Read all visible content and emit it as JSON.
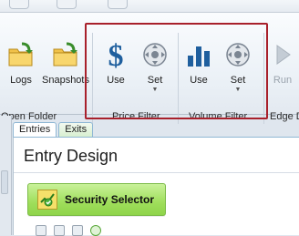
{
  "ribbon": {
    "open_folder": {
      "label": "Open Folder",
      "buttons": [
        {
          "label": "Logs",
          "icon": "folder-arrow-icon"
        },
        {
          "label": "Snapshots",
          "icon": "folder-arrow-icon"
        }
      ]
    },
    "price_filter": {
      "label": "Price Filter",
      "use_label": "Use",
      "set_label": "Set",
      "use_icon": "dollar-icon",
      "set_icon": "settings-dial-icon"
    },
    "volume_filter": {
      "label": "Volume Filter",
      "use_label": "Use",
      "set_label": "Set",
      "use_icon": "bar-chart-icon",
      "set_icon": "settings-dial-icon"
    },
    "edge": {
      "label": "Edge D",
      "run_label": "Run",
      "run_icon": "play-icon"
    }
  },
  "tabs": [
    {
      "label": "Entries",
      "active": true
    },
    {
      "label": "Exits",
      "active": false
    }
  ],
  "main": {
    "title": "Entry Design",
    "security_selector_label": "Security Selector"
  },
  "colors": {
    "highlight_border": "#a8202b",
    "dollar_blue": "#1f5f9e",
    "tab_border": "#8fb7d4",
    "selector_green": "#9fde5b"
  }
}
